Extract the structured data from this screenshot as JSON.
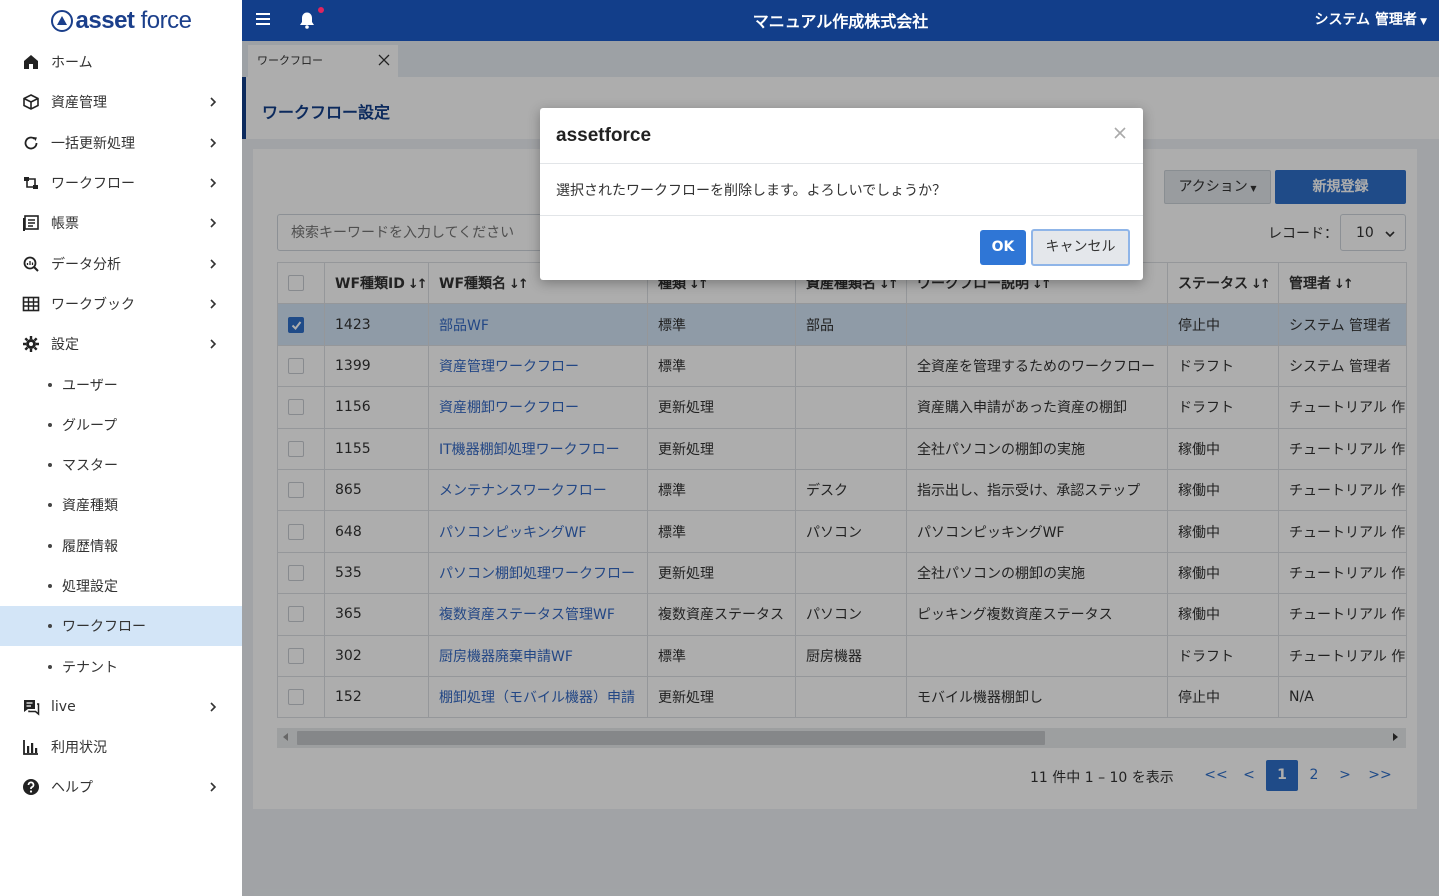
{
  "logo": {
    "text_a": "asset",
    "text_b": "force"
  },
  "sidebar": {
    "items": [
      {
        "label": "ホーム",
        "icon": "home-icon"
      },
      {
        "label": "資産管理",
        "icon": "cube-icon"
      },
      {
        "label": "一括更新処理",
        "icon": "refresh-icon"
      },
      {
        "label": "ワークフロー",
        "icon": "workflow-icon"
      },
      {
        "label": "帳票",
        "icon": "report-icon"
      },
      {
        "label": "データ分析",
        "icon": "analysis-icon"
      },
      {
        "label": "ワークブック",
        "icon": "table-icon"
      },
      {
        "label": "設定",
        "icon": "gear-icon"
      }
    ],
    "settings_sub": [
      "ユーザー",
      "グループ",
      "マスター",
      "資産種類",
      "履歴情報",
      "処理設定",
      "ワークフロー",
      "テナント"
    ],
    "items_after": [
      {
        "label": "live",
        "icon": "chat-icon"
      },
      {
        "label": "利用状況",
        "icon": "bar-chart-icon"
      },
      {
        "label": "ヘルプ",
        "icon": "help-icon"
      }
    ]
  },
  "topbar": {
    "company": "マニュアル作成株式会社",
    "user": "システム 管理者"
  },
  "tab": {
    "label": "ワークフロー"
  },
  "page": {
    "title": "ワークフロー設定"
  },
  "toolbar": {
    "action_label": "アクション",
    "new_label": "新規登録"
  },
  "search": {
    "placeholder": "検索キーワードを入力してください"
  },
  "records": {
    "label": "レコード：",
    "value": "10"
  },
  "table": {
    "headers": [
      "WF種類ID",
      "WF種類名",
      "種類",
      "資産種類名",
      "ワークフロー説明",
      "ステータス",
      "管理者"
    ],
    "rows": [
      {
        "id": "1423",
        "name": "部品WF",
        "type": "標準",
        "asset": "部品",
        "desc": "",
        "status": "停止中",
        "admin": "システム 管理者",
        "checked": true
      },
      {
        "id": "1399",
        "name": "資産管理ワークフロー",
        "type": "標準",
        "asset": "",
        "desc": "全資産を管理するためのワークフロー",
        "status": "ドラフト",
        "admin": "システム 管理者",
        "checked": false
      },
      {
        "id": "1156",
        "name": "資産棚卸ワークフロー",
        "type": "更新処理",
        "asset": "",
        "desc": "資産購入申請があった資産の棚卸",
        "status": "ドラフト",
        "admin": "チュートリアル 作",
        "checked": false
      },
      {
        "id": "1155",
        "name": "IT機器棚卸処理ワークフロー",
        "type": "更新処理",
        "asset": "",
        "desc": "全社パソコンの棚卸の実施",
        "status": "稼働中",
        "admin": "チュートリアル 作",
        "checked": false
      },
      {
        "id": "865",
        "name": "メンテナンスワークフロー",
        "type": "標準",
        "asset": "デスク",
        "desc": "指示出し、指示受け、承認ステップ",
        "status": "稼働中",
        "admin": "チュートリアル 作",
        "checked": false
      },
      {
        "id": "648",
        "name": "パソコンピッキングWF",
        "type": "標準",
        "asset": "パソコン",
        "desc": "パソコンピッキングWF",
        "status": "稼働中",
        "admin": "チュートリアル 作",
        "checked": false
      },
      {
        "id": "535",
        "name": "パソコン棚卸処理ワークフロー",
        "type": "更新処理",
        "asset": "",
        "desc": "全社パソコンの棚卸の実施",
        "status": "稼働中",
        "admin": "チュートリアル 作",
        "checked": false
      },
      {
        "id": "365",
        "name": "複数資産ステータス管理WF",
        "type": "複数資産ステータス",
        "asset": "パソコン",
        "desc": "ピッキング複数資産ステータス",
        "status": "稼働中",
        "admin": "チュートリアル 作",
        "checked": false
      },
      {
        "id": "302",
        "name": "厨房機器廃棄申請WF",
        "type": "標準",
        "asset": "厨房機器",
        "desc": "",
        "status": "ドラフト",
        "admin": "チュートリアル 作",
        "checked": false
      },
      {
        "id": "152",
        "name": "棚卸処理（モバイル機器）申請",
        "type": "更新処理",
        "asset": "",
        "desc": "モバイル機器棚卸し",
        "status": "停止中",
        "admin": "N/A",
        "checked": false
      }
    ]
  },
  "pager": {
    "info": "11 件中 1 – 10 を表示",
    "first": "<<",
    "prev": "<",
    "pages": [
      "1",
      "2"
    ],
    "next": ">",
    "last": ">>"
  },
  "modal": {
    "title": "assetforce",
    "message": "選択されたワークフローを削除します。よろしいでしょうか？",
    "ok": "OK",
    "cancel": "キャンセル"
  },
  "colors": {
    "navy": "#123e8a",
    "accent": "#2f6fc9",
    "selected_row": "#d3e5f7"
  }
}
